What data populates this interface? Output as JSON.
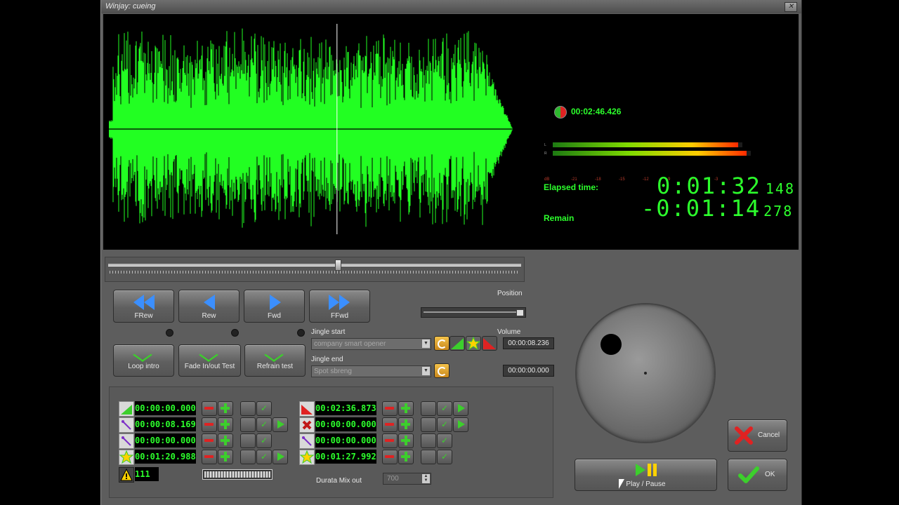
{
  "window": {
    "title": "Winjay: cueing",
    "close_glyph": "✕"
  },
  "display": {
    "marker_time": "00:02:46.426",
    "elapsed_label": "Elapsed time:",
    "remain_label": "Remain",
    "elapsed_main": "0:01:32",
    "elapsed_ms": "148",
    "remain_main": "-0:01:14",
    "remain_ms": "278",
    "meter": {
      "left_label": "L",
      "right_label": "R",
      "left_level": 0.88,
      "right_level": 0.92,
      "scale": [
        "dB",
        "-21",
        "-18",
        "-15",
        "-12",
        "-9",
        "-6",
        "-3",
        "0"
      ]
    },
    "playhead_fraction": 0.56
  },
  "seek": {
    "position_fraction": 0.55
  },
  "transport": [
    {
      "label": "FRew",
      "icon": "fast-rewind-icon"
    },
    {
      "label": "Rew",
      "icon": "rewind-icon"
    },
    {
      "label": "Fwd",
      "icon": "forward-icon"
    },
    {
      "label": "FFwd",
      "icon": "fast-forward-icon"
    }
  ],
  "modes": [
    {
      "label": "Loop intro"
    },
    {
      "label": "Fade In/out Test"
    },
    {
      "label": "Refrain test"
    }
  ],
  "position_label": "Position",
  "jingle_start": {
    "label": "Jingle start",
    "value": "company smart opener"
  },
  "jingle_end": {
    "label": "Jingle end",
    "value": "Spot sbreng"
  },
  "volume": {
    "label": "Volume",
    "start_time": "00:00:08.236",
    "end_time": "00:00:00.000"
  },
  "cue_left": [
    {
      "time": "00:00:00.000",
      "icon": "intro-ramp-icon",
      "has_play": false
    },
    {
      "time": "00:00:08.169",
      "icon": "wand-icon",
      "has_play": true
    },
    {
      "time": "00:00:00.000",
      "icon": "wand-icon",
      "has_play": false
    },
    {
      "time": "00:01:20.988",
      "icon": "star-icon",
      "has_play": true
    }
  ],
  "cue_left_extra": "111",
  "cue_right": [
    {
      "time": "00:02:36.873",
      "icon": "outro-ramp-icon",
      "has_play": true
    },
    {
      "time": "00:00:00.000",
      "icon": "cross-icon",
      "has_play": true
    },
    {
      "time": "00:00:00.000",
      "icon": "wand-icon",
      "has_play": false
    },
    {
      "time": "00:01:27.992",
      "icon": "star-icon",
      "has_play": false
    }
  ],
  "durata": {
    "label": "Durata Mix out",
    "value": "700"
  },
  "play_pause": {
    "label": "Play / Pause"
  },
  "cancel": {
    "label": "Cancel"
  },
  "ok": {
    "label": "OK"
  },
  "colors": {
    "wave": "#22ff22",
    "lcd": "#2cff2c",
    "panel": "#5d5d5d"
  }
}
